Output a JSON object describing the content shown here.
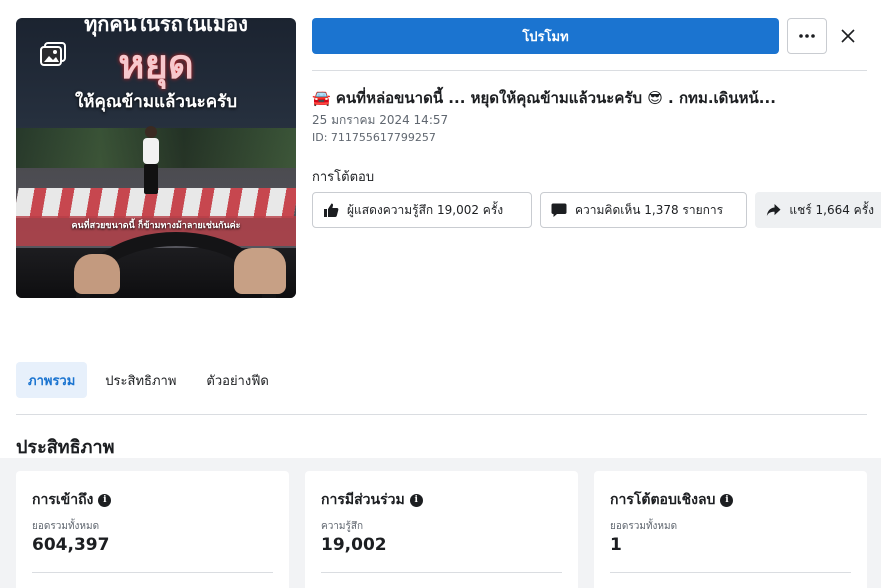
{
  "thumbnail": {
    "heading_top": "ทุกคนในรถในเมือง",
    "heading_big": "หยุด",
    "subheading": "ให้คุณข้ามแล้วนะครับ",
    "caption": "คนที่สวยขนาดนี้ ก็ข้ามทางม้าลายเช่นกันค่ะ"
  },
  "actions": {
    "promote_label": "โปรโมท",
    "more_label": "···",
    "close_label": "×"
  },
  "post": {
    "title": "🚘 คนที่หล่อขนาดนี้ ... หยุดให้คุณข้ามแล้วนะครับ 😎 . กทม.เดินหน้...",
    "date": "25 มกราคม 2024 14:57",
    "id": "ID: 711755617799257"
  },
  "interactions": {
    "label": "การโต้ตอบ",
    "reactions": "ผู้แสดงความรู้สึก 19,002 ครั้ง",
    "comments": "ความคิดเห็น 1,378 รายการ",
    "shares": "แชร์ 1,664 ครั้ง"
  },
  "tabs": [
    {
      "label": "ภาพรวม",
      "active": true
    },
    {
      "label": "ประสิทธิภาพ",
      "active": false
    },
    {
      "label": "ตัวอย่างฟีด",
      "active": false
    }
  ],
  "performance": {
    "heading": "ประสิทธิภาพ",
    "cards": [
      {
        "title": "การเข้าถึง",
        "sub": "ยอดรวมทั้งหมด",
        "value": "604,397"
      },
      {
        "title": "การมีส่วนร่วม",
        "sub": "ความรู้สึก",
        "value": "19,002"
      },
      {
        "title": "การโต้ตอบเชิงลบ",
        "sub": "ยอดรวมทั้งหมด",
        "value": "1"
      }
    ]
  },
  "colors": {
    "primary": "#1b74d0",
    "active_tab_bg": "#e7f0fb",
    "panel_bg": "#f2f3f5"
  }
}
